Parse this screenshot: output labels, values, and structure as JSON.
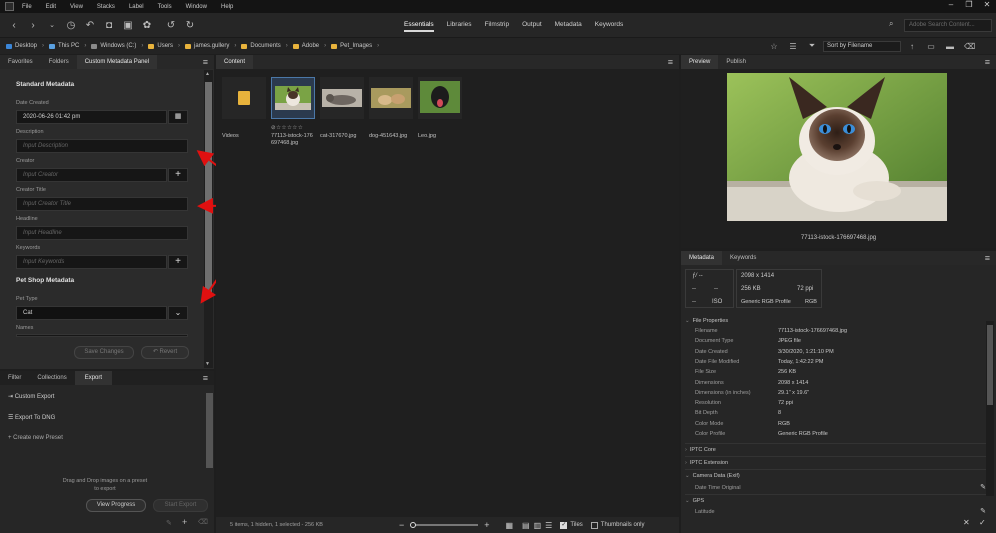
{
  "menubar": {
    "items": [
      "File",
      "Edit",
      "View",
      "Stacks",
      "Label",
      "Tools",
      "Window",
      "Help"
    ],
    "window_controls": [
      "–",
      "❐",
      "✕"
    ]
  },
  "workspaces": [
    "Essentials",
    "Libraries",
    "Filmstrip",
    "Output",
    "Metadata",
    "Keywords"
  ],
  "search": {
    "placeholder": "Adobe Search Content..."
  },
  "breadcrumb": [
    "Desktop",
    "This PC",
    "Windows (C:)",
    "Users",
    "james.gullery",
    "Documents",
    "Adobe",
    "Pet_Images"
  ],
  "sort": {
    "label": "Sort by Filename"
  },
  "left_tabs": [
    "Favorites",
    "Folders",
    "Custom Metadata Panel"
  ],
  "metadata_form": {
    "standard_title": "Standard Metadata",
    "date_created_label": "Date Created",
    "date_created_value": "2020-06-26 01:42 pm",
    "description_label": "Description",
    "description_placeholder": "Input Description",
    "creator_label": "Creator",
    "creator_placeholder": "Input Creator",
    "creator_title_label": "Creator Title",
    "creator_title_placeholder": "Input Creator Title",
    "headline_label": "Headline",
    "headline_placeholder": "Input Headline",
    "keywords_label": "Keywords",
    "keywords_placeholder": "Input Keywords",
    "petshop_title": "Pet Shop Metadata",
    "pet_type_label": "Pet Type",
    "pet_type_value": "Cat",
    "names_label": "Names",
    "save_label": "Save Changes",
    "revert_label": "Revert"
  },
  "bottom_tabs": [
    "Filter",
    "Collections",
    "Export"
  ],
  "export": {
    "items": [
      "Custom Export",
      "Export To DNG",
      "Create new Preset"
    ],
    "hint": "Drag and Drop images on a preset to export",
    "view_progress": "View Progress",
    "start_export": "Start Export"
  },
  "content_tab": "Content",
  "thumbs": [
    {
      "label": "Videos"
    },
    {
      "label": "77113-istock-176697468.jpg",
      "rating": "⊘☆☆☆☆☆"
    },
    {
      "label": "cat-317670.jpg"
    },
    {
      "label": "dog-451643.jpg"
    },
    {
      "label": "Leo.jpg"
    }
  ],
  "status": {
    "text": "5 items, 1 hidden, 1 selected - 256 KB",
    "tiles": "Tiles",
    "thumbs_only": "Thumbnails only"
  },
  "preview": {
    "tabs": [
      "Preview",
      "Publish"
    ],
    "caption": "77113-istock-176697468.jpg"
  },
  "meta_tabs": [
    "Metadata",
    "Keywords"
  ],
  "meta_summary": {
    "fstop": "ƒ/ --",
    "dash1": "--",
    "dash2": "--",
    "dash3": "--",
    "iso": "ISO",
    "dims": "2098 x 1414",
    "size": "256 KB",
    "ppi": "72 ppi",
    "profile": "Generic RGB Profile",
    "mode": "RGB"
  },
  "file_properties": {
    "title": "File Properties",
    "rows": [
      [
        "Filename",
        "77113-istock-176697468.jpg"
      ],
      [
        "Document Type",
        "JPEG file"
      ],
      [
        "Date Created",
        "3/30/2020, 1:21:10 PM"
      ],
      [
        "Date File Modified",
        "Today, 1:42:22 PM"
      ],
      [
        "File Size",
        "256 KB"
      ],
      [
        "Dimensions",
        "2098 x 1414"
      ],
      [
        "Dimensions (in inches)",
        "29.1\" x 19.6\""
      ],
      [
        "Resolution",
        "72 ppi"
      ],
      [
        "Bit Depth",
        "8"
      ],
      [
        "Color Mode",
        "RGB"
      ],
      [
        "Color Profile",
        "Generic RGB Profile"
      ]
    ]
  },
  "meta_sections": [
    "IPTC Core",
    "IPTC Extension",
    "Camera Data (Exif)",
    "GPS"
  ],
  "camera_row": "Date Time Original",
  "gps_row": "Latitude"
}
